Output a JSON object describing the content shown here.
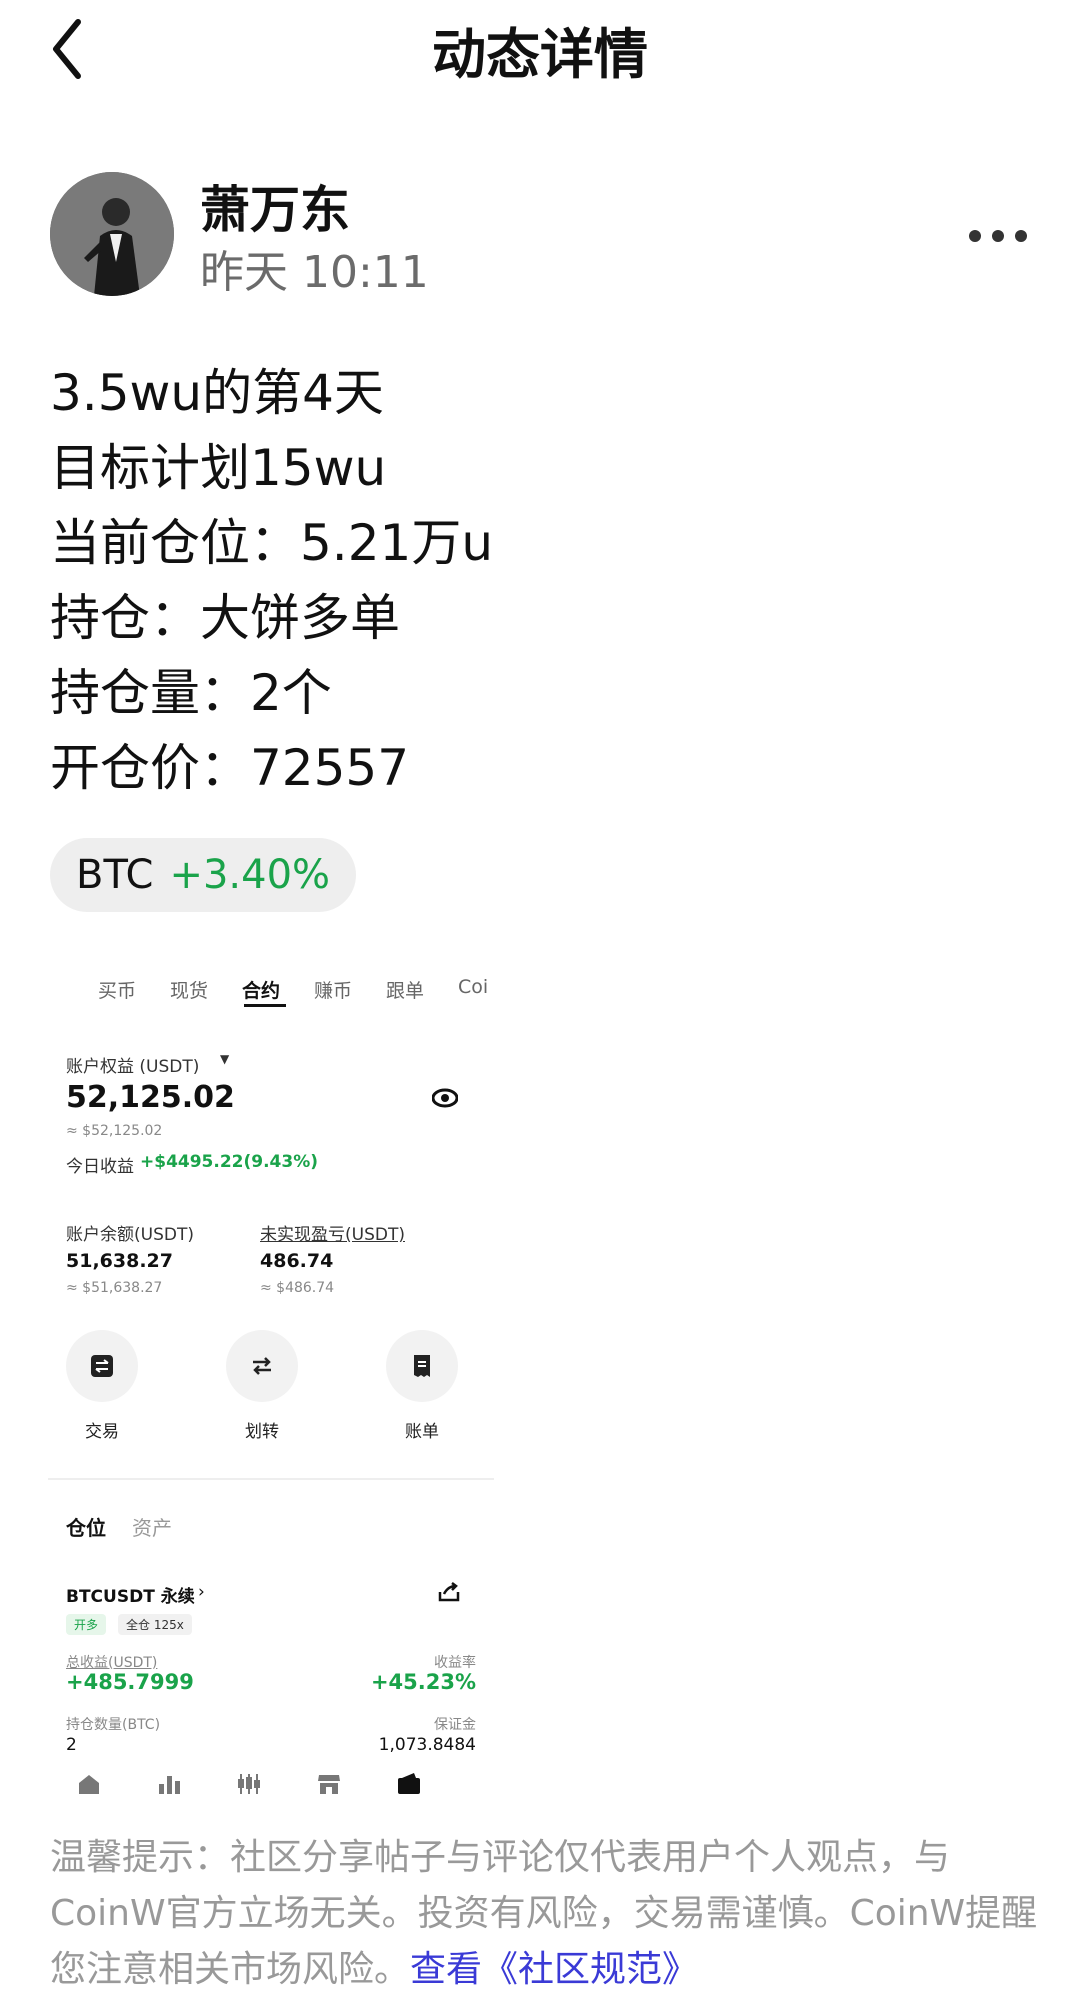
{
  "header": {
    "title": "动态详情"
  },
  "author": {
    "name": "萧万东",
    "time": "昨天 10:11"
  },
  "post": {
    "lines": [
      "3.5wu的第4天",
      "目标计划15wu",
      "当前仓位：5.21万u",
      "持仓：大饼多单",
      "持仓量：2个",
      "开仓价：72557"
    ]
  },
  "ticker": {
    "symbol": "BTC",
    "change": "+3.40%",
    "change_color": "#1aa34a"
  },
  "screenshot": {
    "tabs": [
      "买币",
      "现货",
      "合约",
      "赚币",
      "跟单",
      "Coi"
    ],
    "active_tab": "合约",
    "equity_label": "账户权益 (USDT)",
    "equity_value": "52,125.02",
    "equity_usd": "≈ $52,125.02",
    "today_pnl_label": "今日收益",
    "today_pnl_value": "+$4495.22(9.43%)",
    "balance_label": "账户余额(USDT)",
    "balance_value": "51,638.27",
    "balance_usd": "≈ $51,638.27",
    "unrealized_label": "未实现盈亏(USDT)",
    "unrealized_value": "486.74",
    "unrealized_usd": "≈ $486.74",
    "actions": [
      "交易",
      "划转",
      "账单"
    ],
    "section_tabs": [
      "仓位",
      "资产"
    ],
    "position": {
      "pair": "BTCUSDT 永续",
      "badge_side": "开多",
      "badge_margin": "全仓 125x",
      "total_pnl_label": "总收益(USDT)",
      "total_pnl_value": "+485.7999",
      "roi_label": "收益率",
      "roi_value": "+45.23%",
      "qty_label": "持仓数量(BTC)",
      "qty_value": "2",
      "margin_label": "保证金",
      "margin_value": "1,073.8484"
    },
    "bottom_nav_icons": [
      "home-icon",
      "bar-chart-icon",
      "candlestick-icon",
      "store-icon",
      "wallet-icon"
    ]
  },
  "disclaimer": {
    "text": "温馨提示：社区分享帖子与评论仅代表用户个人观点，与CoinW官方立场无关。投资有风险，交易需谨慎。CoinW提醒您注意相关市场风险。",
    "link": "查看《社区规范》"
  }
}
